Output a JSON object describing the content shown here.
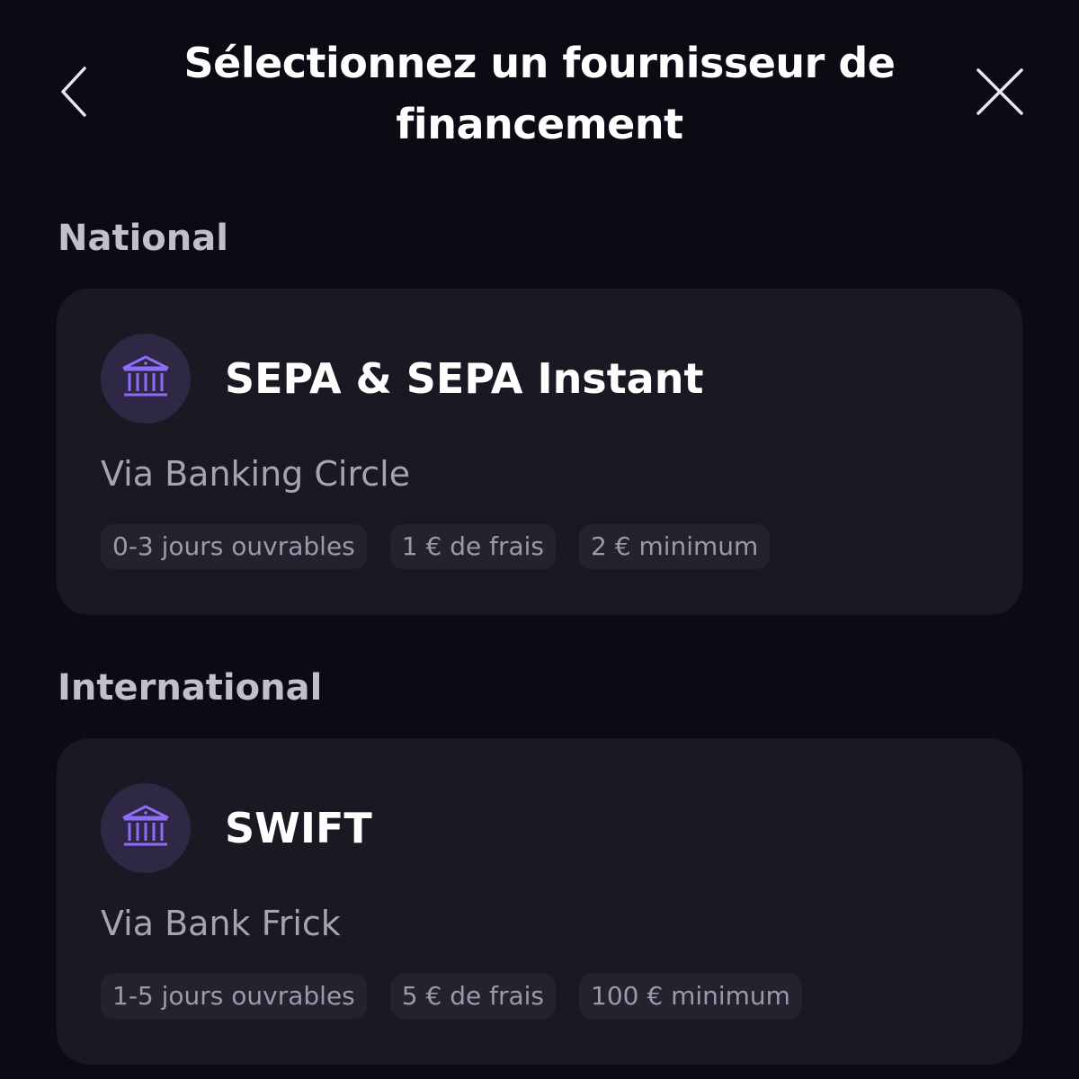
{
  "header": {
    "title": "Sélectionnez un fournisseur de financement"
  },
  "colors": {
    "background": "#0c0a13",
    "card": "#1a1823",
    "chip": "#25222f",
    "icon_circle": "#2e2746",
    "icon_accent": "#8f6cf5"
  },
  "sections": [
    {
      "label": "National",
      "card": {
        "icon": "bank-icon",
        "title": "SEPA & SEPA Instant",
        "subtitle": "Via Banking Circle",
        "chips": [
          "0-3 jours ouvrables",
          "1 € de frais",
          "2 € minimum"
        ]
      }
    },
    {
      "label": "International",
      "card": {
        "icon": "bank-icon",
        "title": "SWIFT",
        "subtitle": "Via Bank Frick",
        "chips": [
          "1-5 jours ouvrables",
          "5 € de frais",
          "100 € minimum"
        ]
      }
    }
  ]
}
